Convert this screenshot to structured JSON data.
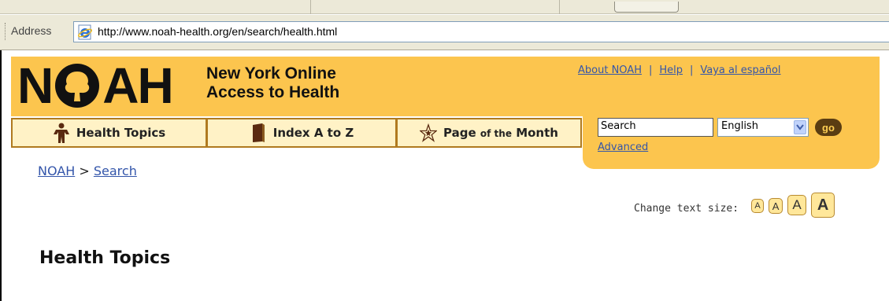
{
  "browser": {
    "address_label": "Address",
    "url": "http://www.noah-health.org/en/search/health.html"
  },
  "site": {
    "logo_text": "NOAH",
    "logo_subtitle_line1": "New York Online",
    "logo_subtitle_line2": "Access to Health",
    "top_links": [
      "About NOAH",
      "Help",
      "Vaya al español"
    ],
    "tabs": [
      {
        "label": "Health Topics",
        "icon": "person-icon"
      },
      {
        "label": "Index A to Z",
        "icon": "book-icon"
      },
      {
        "label_big": "Page",
        "label_small": "of the",
        "label_end": "Month",
        "icon": "star-icon"
      }
    ],
    "search": {
      "value": "Search",
      "language": "English",
      "go_label": "go",
      "advanced_label": "Advanced"
    },
    "colors": {
      "header": "#fcc54e",
      "tab_bg": "#fff2c6",
      "link": "#3355aa",
      "go_bg": "#5a3d12"
    }
  },
  "breadcrumb": {
    "root": "NOAH",
    "separator": ">",
    "current": "Search"
  },
  "text_size": {
    "label": "Change text size:",
    "buttons": [
      "A",
      "A",
      "A",
      "A"
    ]
  },
  "page": {
    "heading": "Health Topics"
  }
}
